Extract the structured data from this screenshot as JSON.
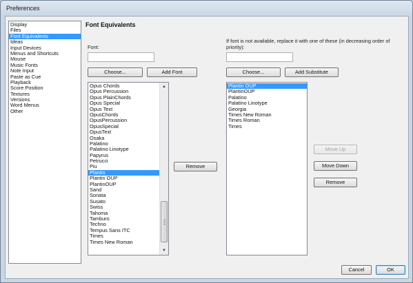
{
  "window": {
    "title": "Preferences"
  },
  "sidebar": {
    "items": [
      {
        "label": "Display"
      },
      {
        "label": "Files"
      },
      {
        "label": "Font Equivalents",
        "selected": true
      },
      {
        "label": "Ideas"
      },
      {
        "label": "Input Devices"
      },
      {
        "label": "Menus and Shortcuts"
      },
      {
        "label": "Mouse"
      },
      {
        "label": "Music Fonts"
      },
      {
        "label": "Note Input"
      },
      {
        "label": "Paste as Cue"
      },
      {
        "label": "Playback"
      },
      {
        "label": "Score Position"
      },
      {
        "label": "Textures"
      },
      {
        "label": "Versions"
      },
      {
        "label": "Word Menus"
      },
      {
        "label": "Other"
      }
    ]
  },
  "page": {
    "title": "Font Equivalents",
    "font_label": "Font:",
    "font_value": "",
    "substitute_label": "If font is not available, replace it with one of these (in decreasing order of priority):",
    "substitute_value": ""
  },
  "left_buttons": {
    "choose": "Choose...",
    "add_font": "Add Font",
    "remove": "Remove"
  },
  "right_buttons": {
    "choose": "Choose...",
    "add_substitute": "Add Substitute",
    "move_up": "Move Up",
    "move_down": "Move Down",
    "remove": "Remove"
  },
  "font_list": [
    {
      "label": "Opus Chords"
    },
    {
      "label": "Opus Percussion"
    },
    {
      "label": "Opus PlainChords"
    },
    {
      "label": "Opus Special"
    },
    {
      "label": "Opus Text"
    },
    {
      "label": "OpusChords"
    },
    {
      "label": "OpusPercussion"
    },
    {
      "label": "OpusSpecial"
    },
    {
      "label": "OpusText"
    },
    {
      "label": "Osaka"
    },
    {
      "label": "Palatino"
    },
    {
      "label": "Palatino Linotype"
    },
    {
      "label": "Papyrus"
    },
    {
      "label": "Petrucci"
    },
    {
      "label": "Piu"
    },
    {
      "label": "Plantin",
      "selected": true
    },
    {
      "label": "Plantin OUP"
    },
    {
      "label": "PlantinOUP"
    },
    {
      "label": "Sand"
    },
    {
      "label": "Sonata"
    },
    {
      "label": "Susato"
    },
    {
      "label": "Swiss"
    },
    {
      "label": "Tahoma"
    },
    {
      "label": "Tamburo"
    },
    {
      "label": "Techno"
    },
    {
      "label": "Tempus Sans ITC"
    },
    {
      "label": "Times"
    },
    {
      "label": "Times New Roman"
    }
  ],
  "substitute_list": [
    {
      "label": "Plantin OUP",
      "selected": true
    },
    {
      "label": "PlantinOUP"
    },
    {
      "label": "Palatino"
    },
    {
      "label": "Palatino Linotype"
    },
    {
      "label": "Georgia"
    },
    {
      "label": "Times New Roman"
    },
    {
      "label": "Times Roman"
    },
    {
      "label": "Times"
    }
  ],
  "footer": {
    "cancel": "Cancel",
    "ok": "OK"
  },
  "icons": {
    "scroll_up": "chevron-up-icon",
    "scroll_down": "chevron-down-icon"
  }
}
